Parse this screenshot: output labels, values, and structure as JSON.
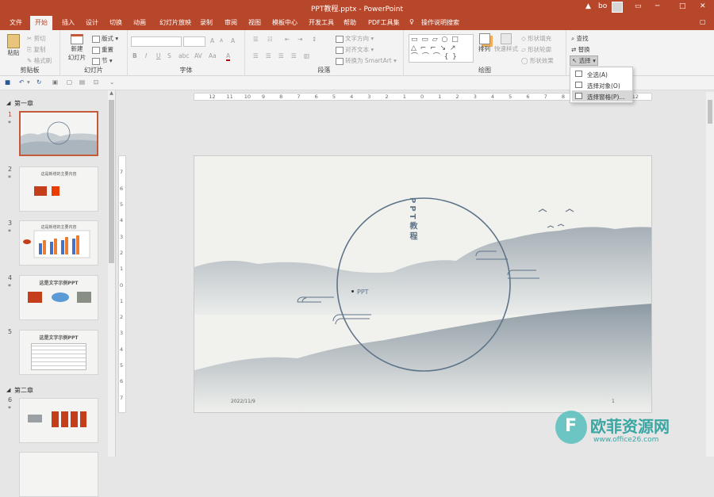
{
  "window": {
    "title": "PPT教程.pptx - PowerPoint",
    "warning_icon": "warning-icon",
    "user_name": "bo",
    "minimize": "─",
    "maximize": "□",
    "close": "✕"
  },
  "tabs": [
    {
      "label": "文件"
    },
    {
      "label": "开始"
    },
    {
      "label": "插入"
    },
    {
      "label": "设计"
    },
    {
      "label": "切换"
    },
    {
      "label": "动画"
    },
    {
      "label": "幻灯片放映"
    },
    {
      "label": "录制"
    },
    {
      "label": "审阅"
    },
    {
      "label": "视图"
    },
    {
      "label": "模板中心"
    },
    {
      "label": "开发工具"
    },
    {
      "label": "帮助"
    },
    {
      "label": "PDF工具集"
    },
    {
      "label": "操作说明搜索"
    }
  ],
  "ribbon": {
    "clipboard": {
      "paste": "粘贴",
      "cut": "剪切",
      "copy": "复制",
      "format_painter": "格式刷",
      "label": "剪贴板"
    },
    "slides": {
      "new_slide": "新建",
      "new_slide2": "幻灯片",
      "layout": "版式",
      "reset": "重置",
      "section": "节",
      "label": "幻灯片"
    },
    "font": {
      "label": "字体",
      "bold": "B",
      "italic": "I",
      "underline": "U",
      "strike": "S",
      "shadow": "abc",
      "spacing": "AV",
      "case": "Aa",
      "color": "A",
      "grow": "A",
      "shrink": "A",
      "clear": "A"
    },
    "paragraph": {
      "label": "段落",
      "text_direction": "文字方向",
      "align_text": "对齐文本",
      "smartart": "转换为 SmartArt"
    },
    "drawing": {
      "label": "绘图",
      "arrange": "排列",
      "quick_styles": "快速样式",
      "shape_fill": "形状填充",
      "shape_outline": "形状轮廓",
      "shape_effects": "形状效果"
    },
    "editing": {
      "find": "查找",
      "replace": "替换",
      "select": "选择"
    }
  },
  "dropdown": {
    "select_all": "全选(A)",
    "select_objects": "选择对象(O)",
    "selection_pane": "选择窗格(P)..."
  },
  "sidebar": {
    "section1": "第一章",
    "section2": "第二章",
    "slides": [
      {
        "num": "1",
        "star": "*",
        "title": ""
      },
      {
        "num": "2",
        "star": "*",
        "title": "这是新增的主要内容"
      },
      {
        "num": "3",
        "star": "*",
        "title": "这是新增的主要内容"
      },
      {
        "num": "4",
        "star": "*",
        "title": "这是文字示例PPT"
      },
      {
        "num": "5",
        "star": "",
        "title": "这是文字示例PPT"
      },
      {
        "num": "6",
        "star": "*",
        "title": ""
      }
    ]
  },
  "ruler": {
    "h_labels": [
      "12",
      "11",
      "10",
      "9",
      "8",
      "7",
      "6",
      "5",
      "4",
      "3",
      "2",
      "1",
      "0",
      "1",
      "2",
      "3",
      "4",
      "5",
      "6",
      "7",
      "8",
      "9",
      "10",
      "11",
      "12"
    ],
    "v_labels": [
      "7",
      "6",
      "5",
      "4",
      "3",
      "2",
      "1",
      "0",
      "1",
      "2",
      "3",
      "4",
      "5",
      "6",
      "7"
    ]
  },
  "slide": {
    "vertical_title": "PPT教程",
    "subtitle": "PPT",
    "date": "2022/11/9",
    "page_num": "1"
  },
  "watermark": {
    "site_name": "欧菲资源网",
    "url": "www.office26.com"
  },
  "colors": {
    "accent": "#b7472a",
    "slide_accent": "#5e7489",
    "ribbon_bg": "#f3f3f3"
  }
}
